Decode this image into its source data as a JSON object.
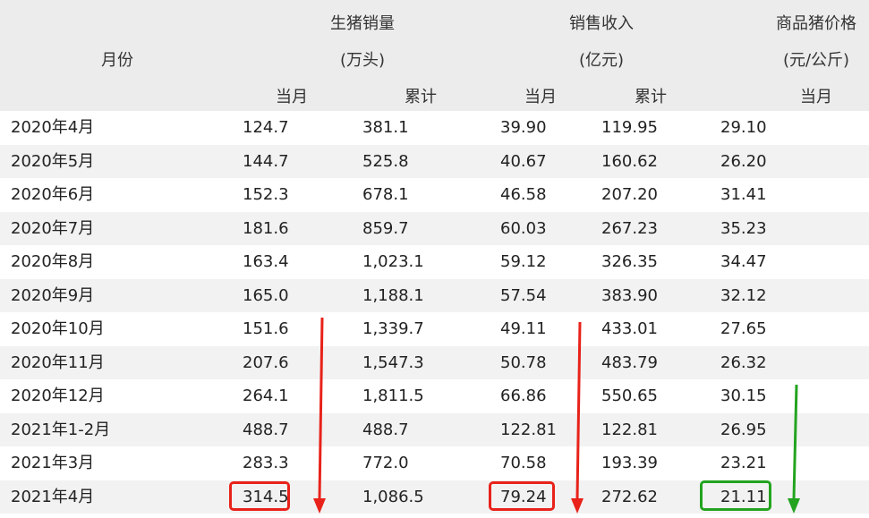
{
  "header": {
    "month": "月份",
    "sales_title": "生猪销量",
    "sales_unit": "(万头)",
    "revenue_title": "销售收入",
    "revenue_unit": "(亿元)",
    "price_title": "商品猪价格",
    "price_unit": "(元/公斤)",
    "current": "当月",
    "cumulative": "累计"
  },
  "rows": [
    {
      "month": "2020年4月",
      "sales_m": "124.7",
      "sales_c": "381.1",
      "rev_m": "39.90",
      "rev_c": "119.95",
      "price": "29.10"
    },
    {
      "month": "2020年5月",
      "sales_m": "144.7",
      "sales_c": "525.8",
      "rev_m": "40.67",
      "rev_c": "160.62",
      "price": "26.20"
    },
    {
      "month": "2020年6月",
      "sales_m": "152.3",
      "sales_c": "678.1",
      "rev_m": "46.58",
      "rev_c": "207.20",
      "price": "31.41"
    },
    {
      "month": "2020年7月",
      "sales_m": "181.6",
      "sales_c": "859.7",
      "rev_m": "60.03",
      "rev_c": "267.23",
      "price": "35.23"
    },
    {
      "month": "2020年8月",
      "sales_m": "163.4",
      "sales_c": "1,023.1",
      "rev_m": "59.12",
      "rev_c": "326.35",
      "price": "34.47"
    },
    {
      "month": "2020年9月",
      "sales_m": "165.0",
      "sales_c": "1,188.1",
      "rev_m": "57.54",
      "rev_c": "383.90",
      "price": "32.12"
    },
    {
      "month": "2020年10月",
      "sales_m": "151.6",
      "sales_c": "1,339.7",
      "rev_m": "49.11",
      "rev_c": "433.01",
      "price": "27.65"
    },
    {
      "month": "2020年11月",
      "sales_m": "207.6",
      "sales_c": "1,547.3",
      "rev_m": "50.78",
      "rev_c": "483.79",
      "price": "26.32"
    },
    {
      "month": "2020年12月",
      "sales_m": "264.1",
      "sales_c": "1,811.5",
      "rev_m": "66.86",
      "rev_c": "550.65",
      "price": "30.15"
    },
    {
      "month": "2021年1-2月",
      "sales_m": "488.7",
      "sales_c": "488.7",
      "rev_m": "122.81",
      "rev_c": "122.81",
      "price": "26.95"
    },
    {
      "month": "2021年3月",
      "sales_m": "283.3",
      "sales_c": "772.0",
      "rev_m": "70.58",
      "rev_c": "193.39",
      "price": "23.21"
    },
    {
      "month": "2021年4月",
      "sales_m": "314.5",
      "sales_c": "1,086.5",
      "rev_m": "79.24",
      "rev_c": "272.62",
      "price": "21.11"
    }
  ],
  "colors": {
    "red_highlight": "#e8221a",
    "green_highlight": "#23a31f",
    "header_bg": "#ececec",
    "stripe_bg": "#f2f2f2"
  }
}
